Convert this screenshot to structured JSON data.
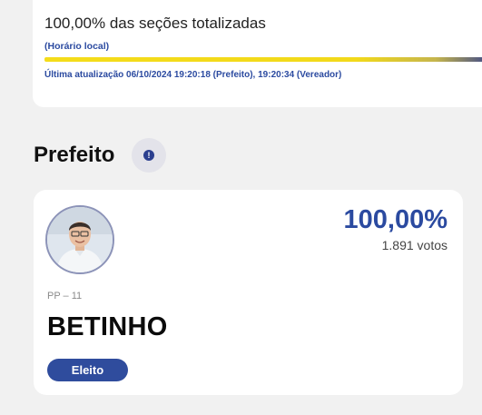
{
  "totalization": {
    "title": "100,00% das seções totalizadas",
    "local_time_note": "(Horário local)",
    "progress_fraction": 1.0,
    "last_update": "Última atualização 06/10/2024 19:20:18 (Prefeito), 19:20:34 (Vereador)"
  },
  "section": {
    "title": "Prefeito",
    "info_icon": "info-icon"
  },
  "candidate": {
    "party": "PP – 11",
    "name": "BETINHO",
    "percent": "100,00%",
    "votes": "1.891 votos",
    "status": "Eleito",
    "photo_icon": "candidate-photo"
  },
  "colors": {
    "accent_blue": "#2b4aa0",
    "badge_blue": "#2f4c9d",
    "progress_yellow": "#f4dc1a"
  }
}
